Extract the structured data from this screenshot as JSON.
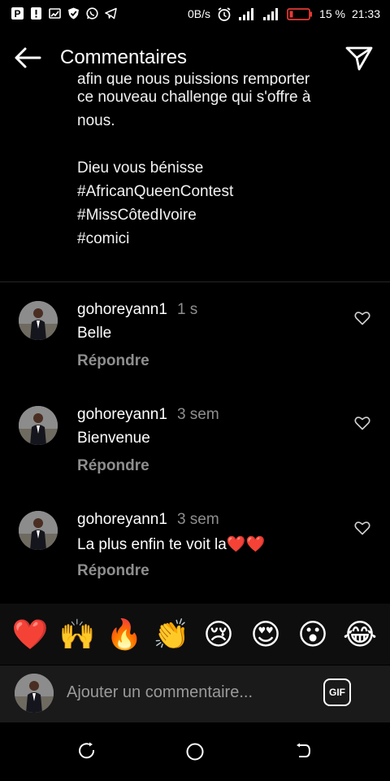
{
  "status_bar": {
    "left_icons": [
      "p-app-icon",
      "alert-icon",
      "cast-icon",
      "shield-icon",
      "whatsapp-icon",
      "telegram-icon"
    ],
    "net_speed": "0B/s",
    "battery": "15 %",
    "time": "21:33",
    "battery_color": "#e53935"
  },
  "app_bar": {
    "title": "Commentaires",
    "back_icon": "back-arrow-icon",
    "send_icon": "paper-plane-icon"
  },
  "caption": {
    "clipped_line": "afin que nous puissions remporter",
    "lines": [
      "ce nouveau challenge qui s'offre à",
      "nous.",
      "",
      "Dieu vous bénisse",
      "#AfricanQueenContest",
      "#MissCôtedIvoire",
      "#comici"
    ]
  },
  "comments": [
    {
      "user": "gohoreyann1",
      "time": "1 s",
      "text": "Belle",
      "reply": "Répondre"
    },
    {
      "user": "gohoreyann1",
      "time": "3 sem",
      "text": "Bienvenue",
      "reply": "Répondre"
    },
    {
      "user": "gohoreyann1",
      "time": "3 sem",
      "text": "La plus enfin te voit la❤️❤️",
      "reply": "Répondre"
    }
  ],
  "emoji_bar": [
    "❤️",
    "🙌",
    "🔥",
    "👏",
    "😢",
    "😍",
    "😮",
    "😂"
  ],
  "composer": {
    "placeholder": "Ajouter un commentaire...",
    "gif_label": "GIF"
  },
  "nav_bar": [
    "recents-icon",
    "home-circle-icon",
    "back-nav-icon"
  ]
}
